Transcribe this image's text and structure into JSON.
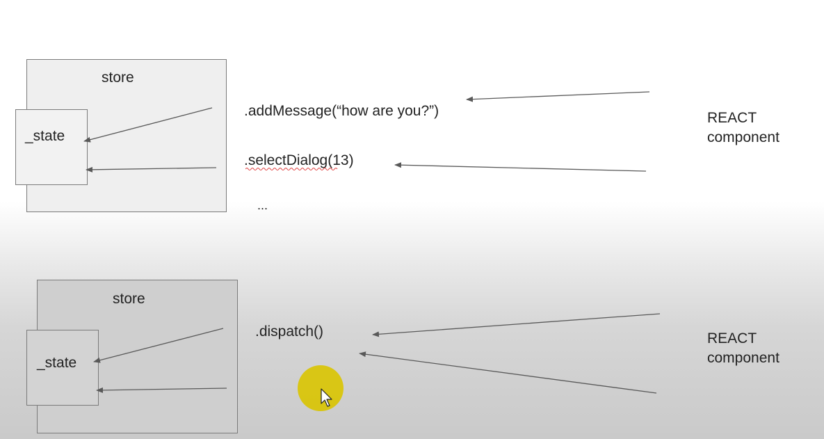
{
  "diagram": {
    "top": {
      "store_label": "store",
      "state_label": "_state",
      "methods": [
        ".addMessage(“how are you?”)",
        ".selectDialog(13)"
      ],
      "ellipsis": "...",
      "component_label_line1": "REACT",
      "component_label_line2": "component"
    },
    "bottom": {
      "store_label": "store",
      "state_label": "_state",
      "method": ".dispatch()",
      "component_label_line1": "REACT",
      "component_label_line2": "component"
    }
  },
  "colors": {
    "top_store_fill": "#efefef",
    "top_state_fill": "#f2f2f2",
    "bottom_store_fill": "#cfcfcf",
    "bottom_state_fill": "#d3d3d3",
    "arrow": "#595959",
    "cursor_highlight": "#d9c400",
    "spellcheck_underline": "#e04040"
  },
  "icons": {
    "cursor": "mouse-pointer-icon"
  }
}
